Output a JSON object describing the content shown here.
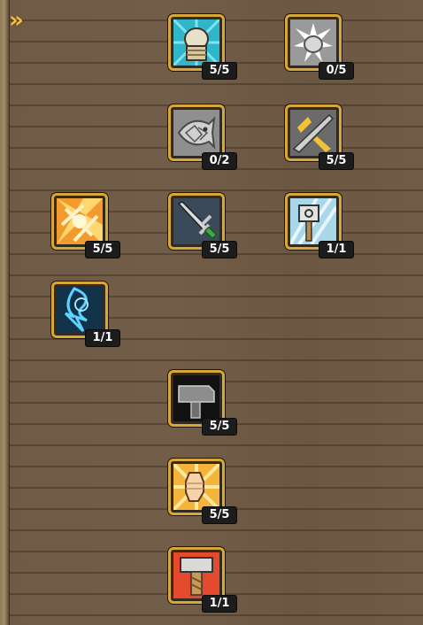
{
  "panel": {
    "collapse_arrow": "»"
  },
  "colors": {
    "frame_gold": "#d6a83a",
    "level_badge_bg": "#1c1c1c",
    "wood": "#6f5b45"
  },
  "skills": [
    {
      "id": "fist-chain",
      "icon": "chained-fist-icon",
      "level": "5/5"
    },
    {
      "id": "shatter",
      "icon": "shatter-fist-icon",
      "level": "0/5"
    },
    {
      "id": "stone-fish",
      "icon": "stone-fish-icon",
      "level": "0/2"
    },
    {
      "id": "sword-slash",
      "icon": "sword-slash-icon",
      "level": "5/5"
    },
    {
      "id": "flame-burst",
      "icon": "flame-burst-icon",
      "level": "5/5"
    },
    {
      "id": "green-sword",
      "icon": "green-hilt-sword-icon",
      "level": "5/5"
    },
    {
      "id": "ice-hammer",
      "icon": "ice-hammer-icon",
      "level": "1/1"
    },
    {
      "id": "lightning",
      "icon": "lightning-icon",
      "level": "1/1"
    },
    {
      "id": "iron-hammer",
      "icon": "iron-hammer-icon",
      "level": "5/5"
    },
    {
      "id": "power-fist",
      "icon": "power-fist-icon",
      "level": "5/5"
    },
    {
      "id": "war-hammer",
      "icon": "war-hammer-icon",
      "level": "1/1"
    }
  ]
}
